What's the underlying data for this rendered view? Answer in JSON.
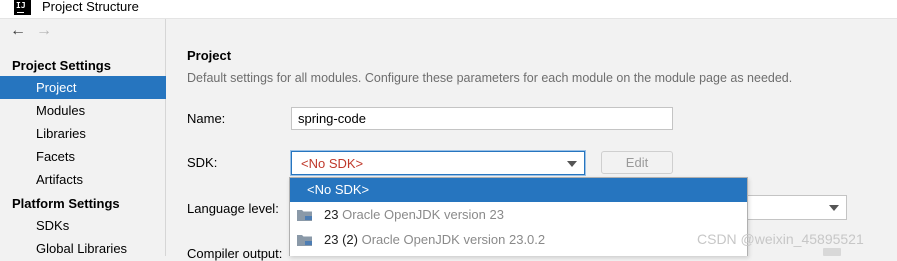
{
  "window": {
    "title": "Project Structure",
    "app_icon_text": "IJ"
  },
  "nav": {
    "back": "←",
    "forward": "→"
  },
  "sidebar": {
    "project_settings_header": "Project Settings",
    "project_items": [
      "Project",
      "Modules",
      "Libraries",
      "Facets",
      "Artifacts"
    ],
    "platform_settings_header": "Platform Settings",
    "platform_items": [
      "SDKs",
      "Global Libraries"
    ],
    "selected": "Project"
  },
  "main": {
    "title": "Project",
    "description": "Default settings for all modules. Configure these parameters for each module on the module page as needed.",
    "name_label": "Name:",
    "name_value": "spring-code",
    "sdk_label": "SDK:",
    "sdk_value": "<No SDK>",
    "edit_button": "Edit",
    "language_level_label": "Language level:",
    "compiler_output_label": "Compiler output:"
  },
  "sdk_dropdown": {
    "options": [
      {
        "label": "<No SDK>",
        "selected": true
      },
      {
        "version": "23",
        "desc": "Oracle OpenJDK version 23",
        "icon": "folder-icon"
      },
      {
        "version": "23 (2)",
        "desc": "Oracle OpenJDK version 23.0.2",
        "icon": "folder-icon"
      }
    ]
  },
  "watermark": "CSDN @weixin_45895521",
  "colors": {
    "accent": "#2675bf",
    "no_sdk_red": "#c0392b",
    "secondary_text": "#6e6e6e",
    "background": "#f2f2f2"
  }
}
